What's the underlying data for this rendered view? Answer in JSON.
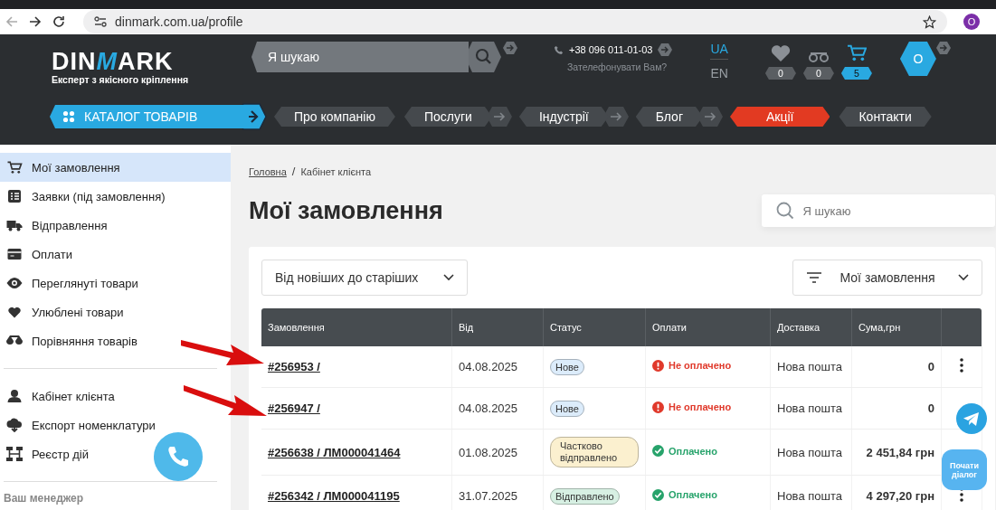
{
  "browser": {
    "url": "dinmark.com.ua/profile",
    "profile": "O"
  },
  "header": {
    "logo": [
      {
        "text": "DIN",
        "accent": false
      },
      {
        "text": "M",
        "accent": true
      },
      {
        "text": "ARK",
        "accent": false
      }
    ],
    "tagline": "Експерт з якісного кріплення",
    "search": {
      "placeholder": "Я шукаю"
    },
    "phone": "+38 096 011-01-03",
    "callback": "Зателефонувати Вам?",
    "languages": [
      {
        "label": "UA",
        "selected": true
      },
      {
        "label": "EN",
        "selected": false
      }
    ],
    "counters": [
      {
        "kind": "heart",
        "count": "0",
        "selected": false
      },
      {
        "kind": "compare",
        "count": "0",
        "selected": false
      },
      {
        "kind": "cart",
        "count": "5",
        "selected": true
      }
    ],
    "account": "О"
  },
  "nav": {
    "catalog": "КАТАЛОГ ТОВАРІВ",
    "items": [
      {
        "label": "Про компанію",
        "arrow": false,
        "kind": "normal"
      },
      {
        "label": "Послуги",
        "arrow": true,
        "kind": "normal"
      },
      {
        "label": "Індустрії",
        "arrow": true,
        "kind": "normal"
      },
      {
        "label": "Блог",
        "arrow": true,
        "kind": "normal"
      },
      {
        "label": "Акції",
        "arrow": false,
        "kind": "promo"
      },
      {
        "label": "Контакти",
        "arrow": false,
        "kind": "normal"
      }
    ]
  },
  "sidebar": {
    "groups": [
      [
        {
          "label": "Мої замовлення",
          "kind": "cart",
          "selected": true
        },
        {
          "label": "Заявки (під замовлення)",
          "kind": "list",
          "selected": false
        },
        {
          "label": "Відправлення",
          "kind": "truck",
          "selected": false
        },
        {
          "label": "Оплати",
          "kind": "card",
          "selected": false
        },
        {
          "label": "Переглянуті товари",
          "kind": "eye",
          "selected": false
        },
        {
          "label": "Улюблені товари",
          "kind": "heart",
          "selected": false
        },
        {
          "label": "Порівняння товарів",
          "kind": "compare",
          "selected": false
        }
      ],
      [
        {
          "label": "Кабінет клієнта",
          "kind": "user",
          "selected": false
        },
        {
          "label": "Експорт номенклатури",
          "kind": "download",
          "selected": false
        },
        {
          "label": "Реєстр дій",
          "kind": "tree",
          "selected": false
        }
      ]
    ],
    "manager": "Ваш менеджер"
  },
  "breadcrumbs": [
    "Головна",
    "Кабінет клієнта"
  ],
  "breadcrumb_separator": "/",
  "title": "Мої замовлення",
  "search": {
    "placeholder": "Я шукаю"
  },
  "sort": "Від новіших до старіших",
  "filter": "Мої замовлення",
  "table": {
    "columns": [
      "Замовлення",
      "Від",
      "Статус",
      "Оплати",
      "Доставка",
      "Сума,грн"
    ],
    "rows": [
      {
        "order": "#256953 /",
        "date": "04.08.2025",
        "status": {
          "label": "Нове",
          "color": "#dcecfb"
        },
        "payment": "Не оплачено",
        "paid": false,
        "delivery": "Нова пошта",
        "sum": "0"
      },
      {
        "order": "#256947 /",
        "date": "04.08.2025",
        "status": {
          "label": "Нове",
          "color": "#dcecfb"
        },
        "payment": "Не оплачено",
        "paid": false,
        "delivery": "Нова пошта",
        "sum": "0"
      },
      {
        "order": "#256638 / ЛМ000041464",
        "date": "01.08.2025",
        "status": {
          "label": "Частково відправлено",
          "color": "#fbf0cf"
        },
        "payment": "Оплачено",
        "paid": true,
        "delivery": "Нова пошта",
        "sum": "2 451,84 грн"
      },
      {
        "order": "#256342 / ЛМ000041195",
        "date": "31.07.2025",
        "status": {
          "label": "Відправлено",
          "color": "#d7f0e3"
        },
        "payment": "Оплачено",
        "paid": true,
        "delivery": "Нова пошта",
        "sum": "4 297,20 грн"
      }
    ]
  },
  "chat_button": "Почати діалог"
}
